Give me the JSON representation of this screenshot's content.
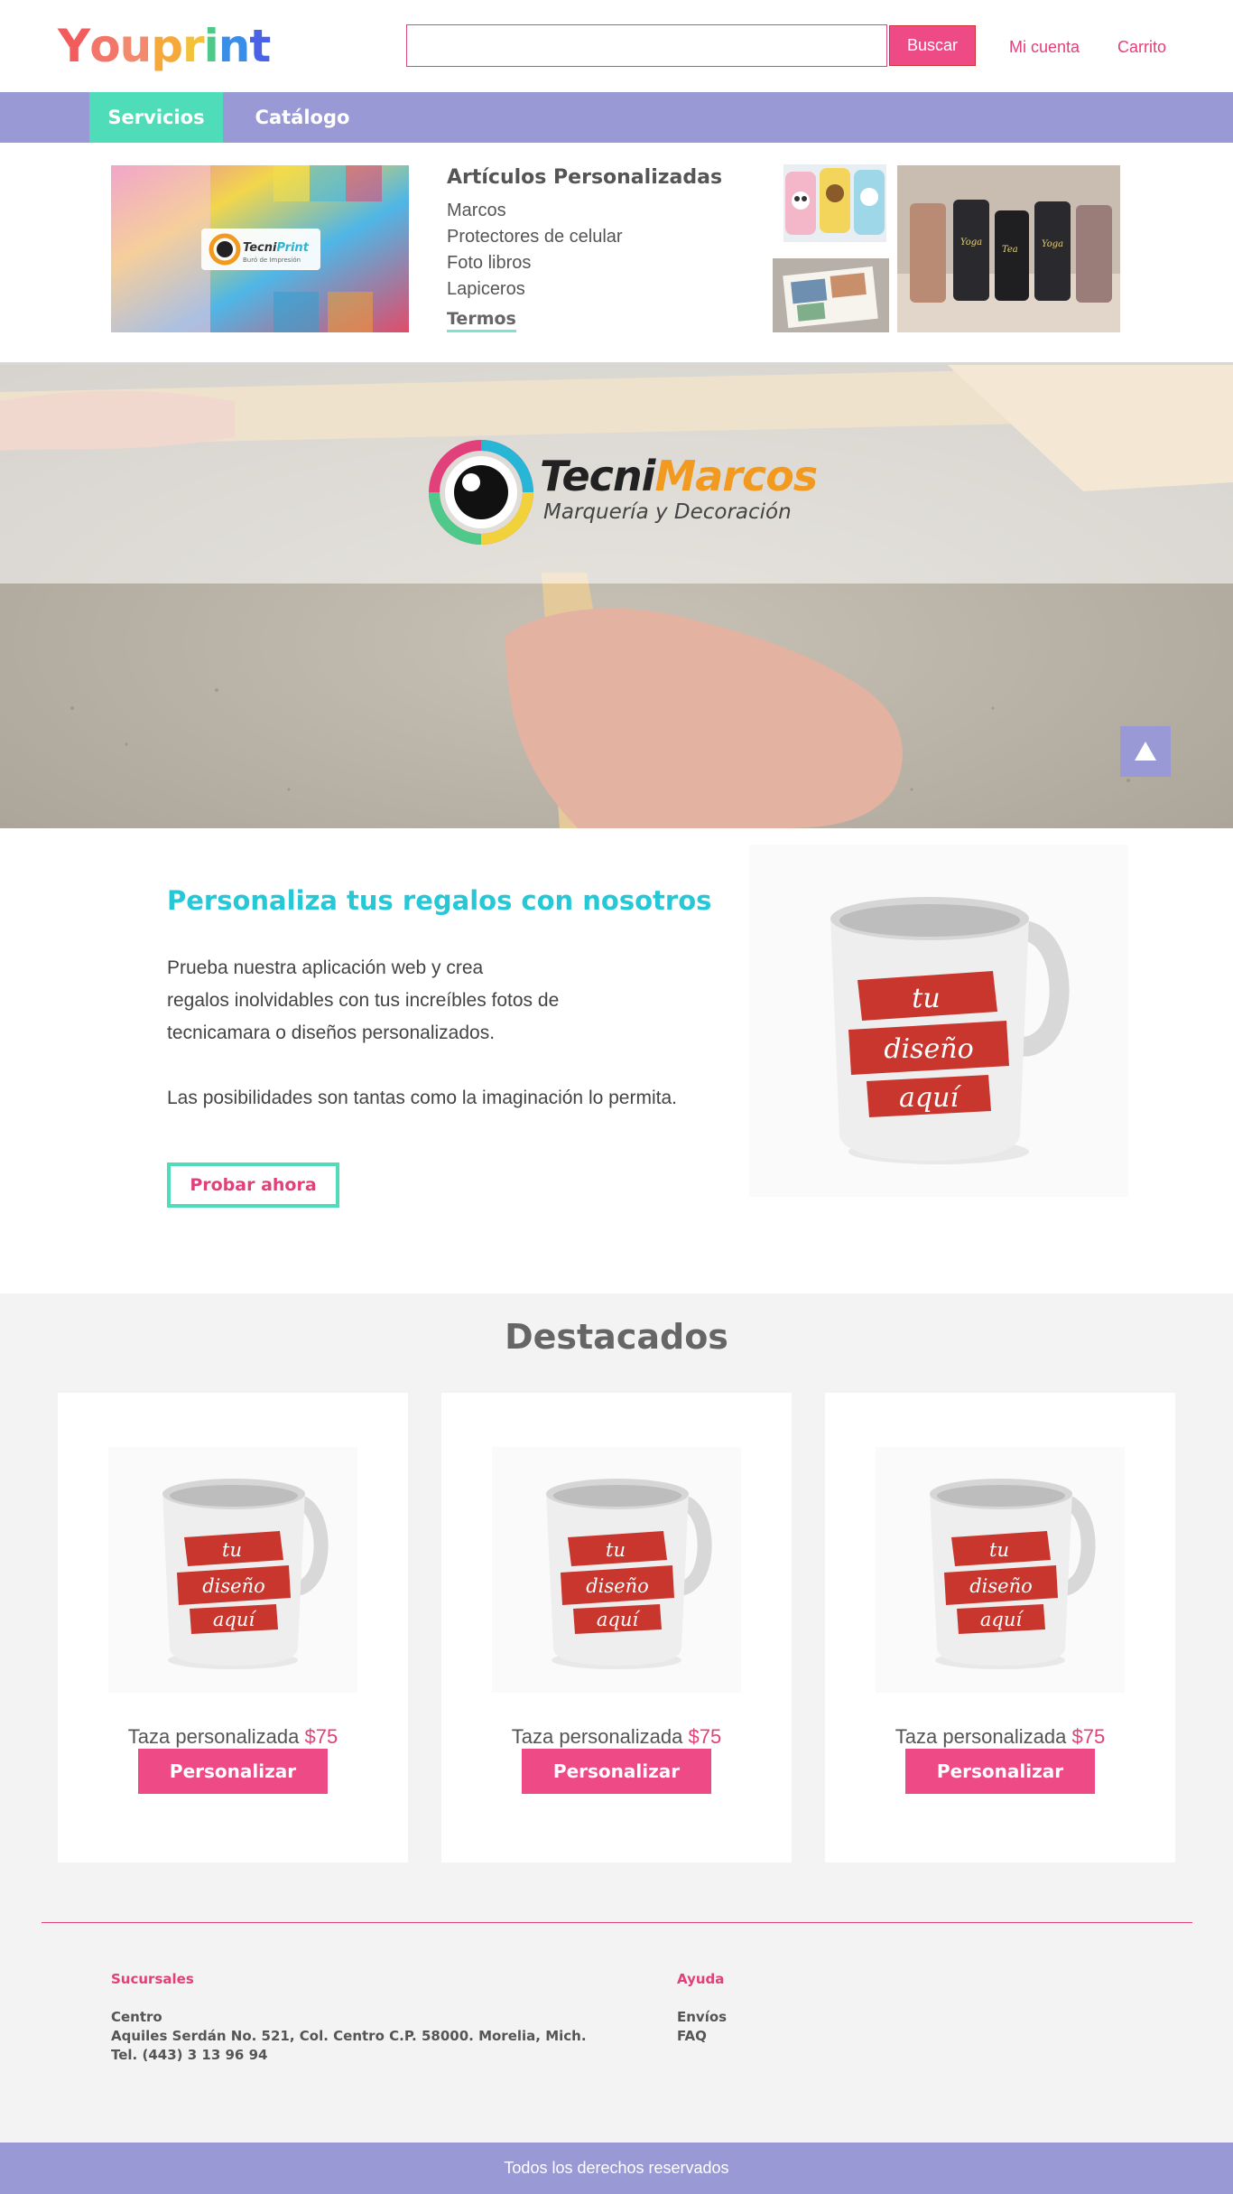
{
  "header": {
    "logo_letters": [
      {
        "char": "Y",
        "color": "#f25c5c"
      },
      {
        "char": "o",
        "color": "#f2766a"
      },
      {
        "char": "u",
        "color": "#f38a6e"
      },
      {
        "char": "p",
        "color": "#f5a93a"
      },
      {
        "char": "r",
        "color": "#f3c13a"
      },
      {
        "char": "i",
        "color": "#4fc98a"
      },
      {
        "char": "n",
        "color": "#3a8ee8"
      },
      {
        "char": "t",
        "color": "#4a63e6"
      }
    ],
    "search": {
      "value": "",
      "placeholder": "",
      "button_label": "Buscar"
    },
    "account_label": "Mi cuenta",
    "cart_label": "Carrito"
  },
  "nav": {
    "items": [
      {
        "label": "Servicios",
        "active": true
      },
      {
        "label": "Catálogo",
        "active": false
      }
    ]
  },
  "dropdown": {
    "title": "Artículos Personalizadas",
    "links": [
      "Marcos",
      "Protectores de celular",
      "Foto libros",
      "Lapiceros"
    ],
    "more_label": "Termos",
    "banner_brand": {
      "part1": "Tecni",
      "part2": "Print",
      "tagline": "Buró de Impresión"
    }
  },
  "hero": {
    "brand_part1": "Tecni",
    "brand_part2": "Marcos",
    "subtitle": "Marquería y Decoración"
  },
  "promo": {
    "title": "Personaliza tus regalos con nosotros",
    "lines": [
      "Prueba nuestra aplicación web y crea",
      "regalos inolvidables con tus increíbles fotos de",
      "tecnicamara o diseños personalizados."
    ],
    "line2": "Las posibilidades son tantas como la imaginación lo permita.",
    "cta_label": "Probar ahora",
    "mug_text": [
      "tu",
      "diseño",
      "aquí"
    ]
  },
  "featured": {
    "title": "Destacados",
    "products": [
      {
        "name": "Taza personalizada",
        "price": "$75",
        "button": "Personalizar"
      },
      {
        "name": "Taza personalizada",
        "price": "$75",
        "button": "Personalizar"
      },
      {
        "name": "Taza personalizada",
        "price": "$75",
        "button": "Personalizar"
      }
    ]
  },
  "footer": {
    "branches_heading": "Sucursales",
    "branch_name": "Centro",
    "branch_address": "Aquiles Serdán No. 521, Col. Centro C.P. 58000. Morelia, Mich.",
    "branch_phone": "Tel. (443) 3 13 96 94",
    "help_heading": "Ayuda",
    "help_links": [
      "Envíos",
      "FAQ"
    ],
    "copyright": "Todos los derechos reservados"
  },
  "colors": {
    "accent_pink": "#ee4a86",
    "nav_purple": "#9999d6",
    "teal": "#4fdcb8",
    "title_cyan": "#27c8d6",
    "orange": "#f29a1f"
  }
}
